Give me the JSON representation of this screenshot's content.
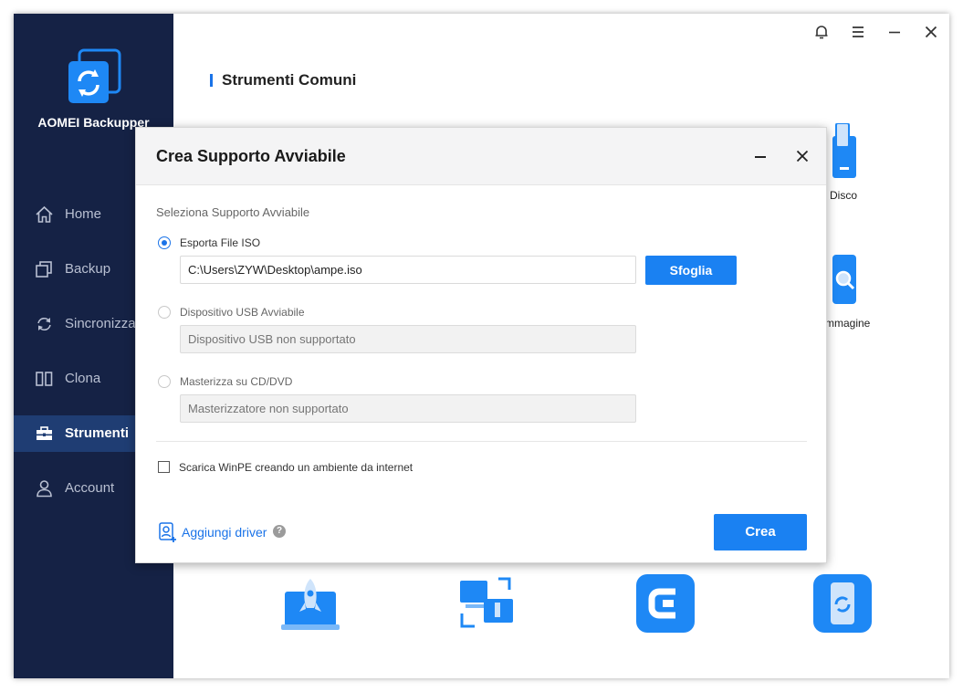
{
  "app": {
    "name": "AOMEI Backupper"
  },
  "nav": [
    {
      "label": "Home",
      "icon": "home-icon"
    },
    {
      "label": "Backup",
      "icon": "backup-icon"
    },
    {
      "label": "Sincronizza",
      "icon": "sync-icon"
    },
    {
      "label": "Clona",
      "icon": "clone-icon"
    },
    {
      "label": "Strumenti",
      "icon": "toolbox-icon",
      "active": true
    },
    {
      "label": "Account",
      "icon": "user-icon"
    }
  ],
  "titlebar": {
    "controls": [
      "bell-icon",
      "menu-icon",
      "minimize-icon",
      "close-icon"
    ]
  },
  "main": {
    "section_title": "Strumenti Comuni",
    "partial_labels": {
      "disk": "Disco",
      "image": "mmagine"
    }
  },
  "dialog": {
    "title": "Crea Supporto Avviabile",
    "subheading": "Seleziona Supporto Avviabile",
    "option_iso": {
      "label": "Esporta File ISO",
      "path_value": "C:\\Users\\ZYW\\Desktop\\ampe.iso",
      "browse_label": "Sfoglia",
      "selected": true
    },
    "option_usb": {
      "label": "Dispositivo USB Avviabile",
      "placeholder": "Dispositivo USB non supportato"
    },
    "option_cd": {
      "label": "Masterizza su CD/DVD",
      "placeholder": "Masterizzatore non supportato"
    },
    "winpe_checkbox": {
      "label": "Scarica WinPE creando un ambiente da internet",
      "checked": false
    },
    "add_driver_label": "Aggiungi driver",
    "help_symbol": "?",
    "create_label": "Crea"
  },
  "colors": {
    "sidebar_bg": "#152245",
    "sidebar_active": "#1f3d73",
    "accent": "#1a81f2"
  }
}
